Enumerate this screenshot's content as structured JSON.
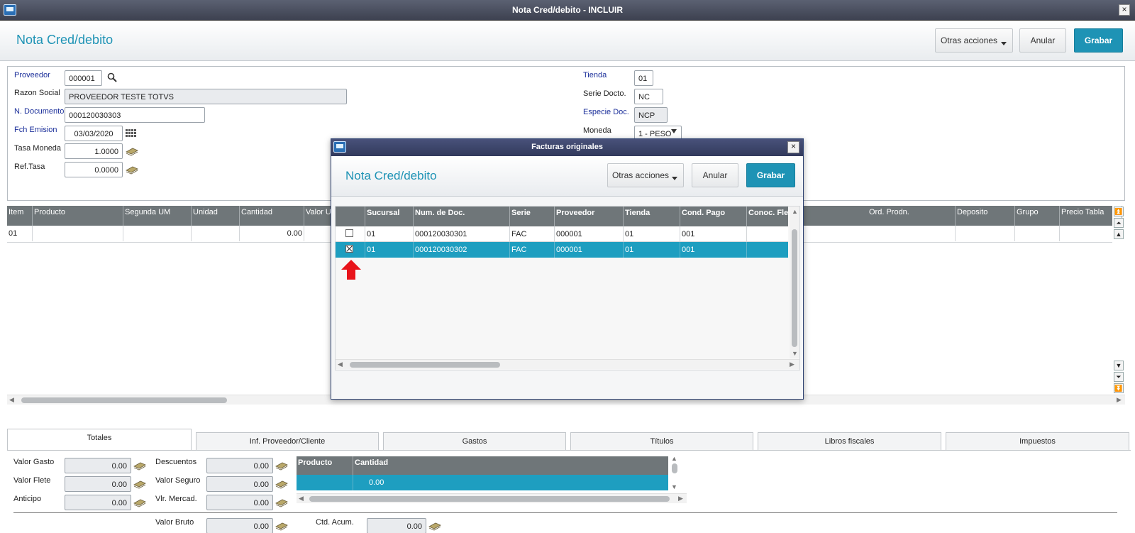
{
  "window": {
    "title": "Nota Cred/debito - INCLUIR",
    "close_glyph": "×"
  },
  "header": {
    "title": "Nota Cred/debito",
    "otras_label": "Otras acciones",
    "anular_label": "Anular",
    "grabar_label": "Grabar"
  },
  "form": {
    "proveedor_label": "Proveedor",
    "proveedor_value": "000001",
    "razon_label": "Razon Social",
    "razon_value": "PROVEEDOR TESTE TOTVS",
    "ndoc_label": "N. Documento",
    "ndoc_value": "000120030303",
    "fch_label": "Fch Emision",
    "fch_value": "03/03/2020",
    "tasa_label": "Tasa Moneda",
    "tasa_value": "1.0000",
    "ref_label": "Ref.Tasa",
    "ref_value": "0.0000",
    "tienda_label": "Tienda",
    "tienda_value": "01",
    "serie_label": "Serie Docto.",
    "serie_value": "NC",
    "especie_label": "Especie Doc.",
    "especie_value": "NCP",
    "moneda_label": "Moneda",
    "moneda_value": "1 - PESO"
  },
  "items_grid": {
    "columns": [
      "Item",
      "Producto",
      "Segunda UM",
      "Unidad",
      "Cantidad",
      "Valor U",
      "Ord. Prodn.",
      "Deposito",
      "Grupo",
      "Precio Tabla"
    ],
    "row": {
      "item": "01",
      "cantidad": "0.00"
    }
  },
  "tabs": [
    "Totales",
    "Inf. Proveedor/Cliente",
    "Gastos",
    "Títulos",
    "Libros fiscales",
    "Impuestos"
  ],
  "totals": {
    "valor_gasto_label": "Valor Gasto",
    "valor_gasto": "0.00",
    "valor_flete_label": "Valor Flete",
    "valor_flete": "0.00",
    "anticipo_label": "Anticipo",
    "anticipo": "0.00",
    "descuentos_label": "Descuentos",
    "descuentos": "0.00",
    "valor_seguro_label": "Valor Seguro",
    "valor_seguro": "0.00",
    "vlr_mercad_label": "Vlr. Mercad.",
    "vlr_mercad": "0.00",
    "valor_bruto_label": "Valor Bruto",
    "valor_bruto": "0.00",
    "ctd_acum_label": "Ctd. Acum.",
    "ctd_acum": "0.00",
    "mini_grid": {
      "col_producto": "Producto",
      "col_cantidad": "Cantidad",
      "row_cantidad": "0.00"
    }
  },
  "modal": {
    "title": "Facturas originales",
    "header_title": "Nota Cred/debito",
    "otras_label": "Otras acciones",
    "anular_label": "Anular",
    "grabar_label": "Grabar",
    "columns": [
      "Sucursal",
      "Num. de Doc.",
      "Serie",
      "Proveedor",
      "Tienda",
      "Cond. Pago",
      "Conoc. Fle"
    ],
    "rows": [
      {
        "sucursal": "01",
        "num_doc": "000120030301",
        "serie": "FAC",
        "proveedor": "000001",
        "tienda": "01",
        "cond_pago": "001",
        "checked": false
      },
      {
        "sucursal": "01",
        "num_doc": "000120030302",
        "serie": "FAC",
        "proveedor": "000001",
        "tienda": "01",
        "cond_pago": "001",
        "checked": true
      }
    ]
  },
  "colors": {
    "accent": "#1e93b5",
    "grid_header": "#6f7679",
    "selected_row": "#1e9ec0",
    "title_bar": "#3d4150",
    "arrow": "#e8141b"
  }
}
